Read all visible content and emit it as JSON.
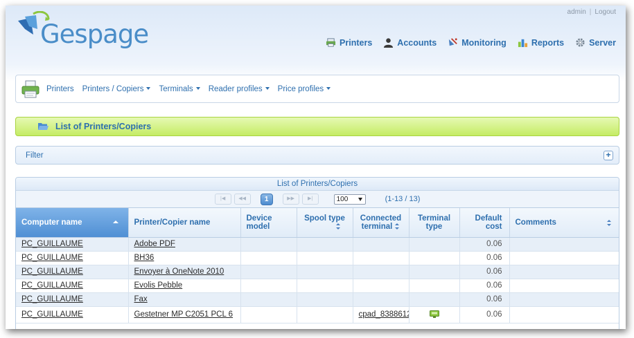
{
  "header": {
    "user": "admin",
    "logout": "Logout",
    "logo_text": "Gespage",
    "nav": [
      {
        "label": "Printers",
        "icon": "printer-icon"
      },
      {
        "label": "Accounts",
        "icon": "user-icon"
      },
      {
        "label": "Monitoring",
        "icon": "satellite-icon"
      },
      {
        "label": "Reports",
        "icon": "bar-chart-icon"
      },
      {
        "label": "Server",
        "icon": "gear-icon"
      }
    ]
  },
  "subnav": {
    "items": [
      {
        "label": "Printers",
        "dropdown": false
      },
      {
        "label": "Printers / Copiers",
        "dropdown": true
      },
      {
        "label": "Terminals",
        "dropdown": true
      },
      {
        "label": "Reader profiles",
        "dropdown": true
      },
      {
        "label": "Price profiles",
        "dropdown": true
      }
    ]
  },
  "section_title": "List of Printers/Copiers",
  "filter": {
    "label": "Filter",
    "toggle": "+"
  },
  "grid": {
    "caption": "List of Printers/Copiers",
    "pager": {
      "first": "|◀",
      "prev": "◀◀",
      "current_page": "1",
      "next": "▶▶",
      "last": "▶|",
      "page_size": "100",
      "range": "(1-13 / 13)"
    },
    "columns": [
      {
        "label": "Computer name",
        "sorted": "asc"
      },
      {
        "label": "Printer/Copier name"
      },
      {
        "label": "Device model"
      },
      {
        "label": "Spool type"
      },
      {
        "label": "Connected terminal"
      },
      {
        "label": "Terminal type"
      },
      {
        "label": "Default cost"
      },
      {
        "label": "Comments"
      }
    ],
    "rows": [
      {
        "computer": "PC_GUILLAUME",
        "printer": "Adobe PDF",
        "model": "",
        "spool": "",
        "terminal": "",
        "terminal_type": "",
        "cost": "0.06",
        "comments": ""
      },
      {
        "computer": "PC_GUILLAUME",
        "printer": "BH36",
        "model": "",
        "spool": "",
        "terminal": "",
        "terminal_type": "",
        "cost": "0.06",
        "comments": ""
      },
      {
        "computer": "PC_GUILLAUME",
        "printer": "Envoyer à OneNote 2010",
        "model": "",
        "spool": "",
        "terminal": "",
        "terminal_type": "",
        "cost": "0.06",
        "comments": ""
      },
      {
        "computer": "PC_GUILLAUME",
        "printer": "Evolis Pebble",
        "model": "",
        "spool": "",
        "terminal": "",
        "terminal_type": "",
        "cost": "0.06",
        "comments": ""
      },
      {
        "computer": "PC_GUILLAUME",
        "printer": "Fax",
        "model": "",
        "spool": "",
        "terminal": "",
        "terminal_type": "",
        "cost": "0.06",
        "comments": ""
      },
      {
        "computer": "PC_GUILLAUME",
        "printer": "Gestetner MP C2051 PCL 6",
        "model": "",
        "spool": "",
        "terminal": "cpad_8388612",
        "terminal_type": "terminal-device-icon",
        "cost": "0.06",
        "comments": ""
      }
    ]
  },
  "colors": {
    "link_blue": "#2e6fae",
    "logo_blue": "#4a8dc8",
    "green_bar": "#c5ec64",
    "active_header": "#4f8fd4",
    "odd_row": "#e7eff8"
  }
}
